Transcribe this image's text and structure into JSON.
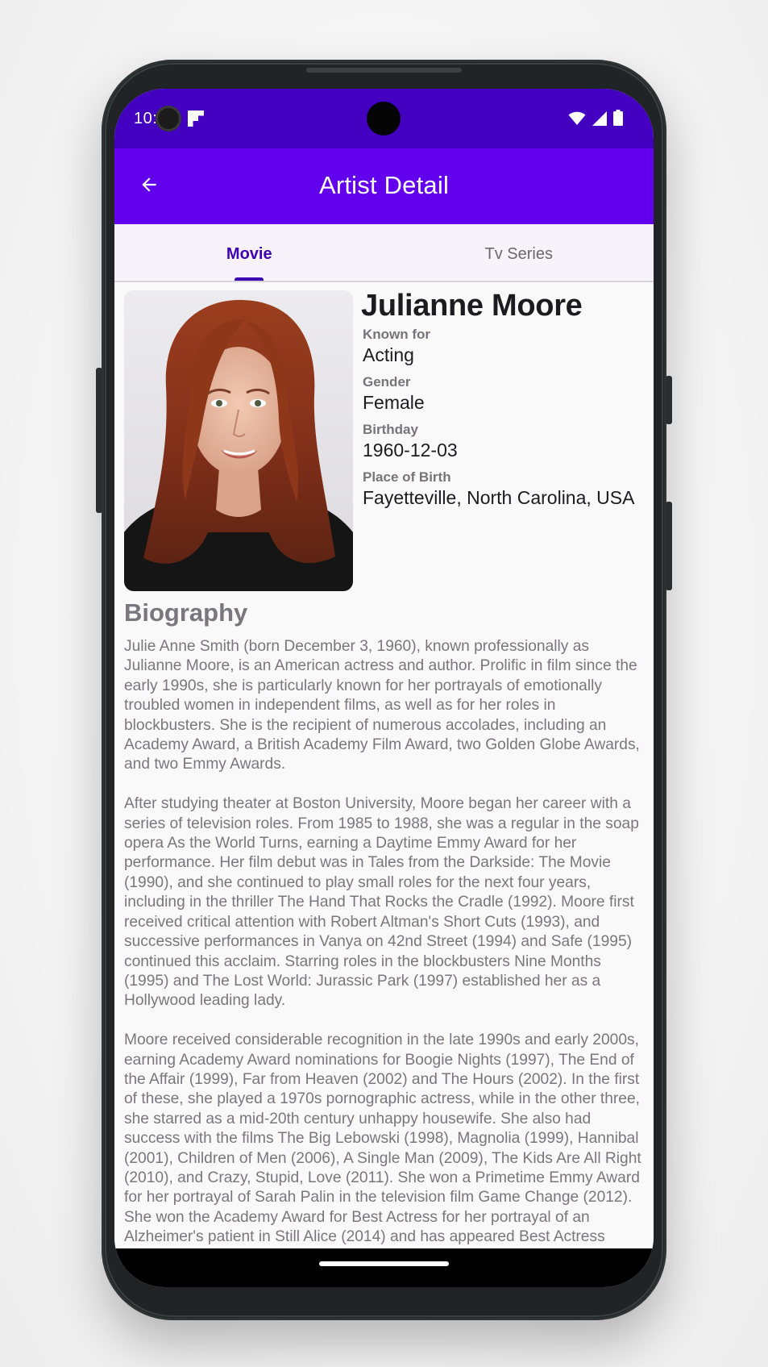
{
  "status_bar": {
    "time": "10:",
    "icons": [
      "flipboard-icon",
      "wifi-icon",
      "signal-icon",
      "battery-icon"
    ]
  },
  "app_bar": {
    "title": "Artist Detail",
    "back_icon": "arrow-back-icon"
  },
  "tabs": [
    {
      "label": "Movie",
      "selected": true
    },
    {
      "label": "Tv Series",
      "selected": false
    }
  ],
  "artist": {
    "name": "Julianne Moore",
    "fields": [
      {
        "label": "Known for",
        "value": "Acting"
      },
      {
        "label": "Gender",
        "value": "Female"
      },
      {
        "label": "Birthday",
        "value": "1960-12-03"
      },
      {
        "label": "Place of Birth",
        "value": "Fayetteville, North Carolina, USA"
      }
    ]
  },
  "biography": {
    "title": "Biography",
    "text": "Julie Anne Smith (born December 3, 1960), known professionally as Julianne Moore, is an American actress and author. Prolific in film since the early 1990s, she is particularly known for her portrayals of emotionally troubled women in independent films, as well as for her roles in blockbusters. She is the recipient of numerous accolades, including an Academy Award, a British Academy Film Award, two Golden Globe Awards, and two Emmy Awards.\n\nAfter studying theater at Boston University, Moore began her career with a series of television roles. From 1985 to 1988, she was a regular in the soap opera As the World Turns, earning a Daytime Emmy Award for her performance. Her film debut was in Tales from the Darkside: The Movie (1990), and she continued to play small roles for the next four years, including in the thriller The Hand That Rocks the Cradle (1992). Moore first received critical attention with Robert Altman's Short Cuts (1993), and successive performances in Vanya on 42nd Street (1994) and Safe (1995) continued this acclaim. Starring roles in the blockbusters Nine Months (1995) and The Lost World: Jurassic Park (1997) established her as a Hollywood leading lady.\n\nMoore received considerable recognition in the late 1990s and early 2000s, earning Academy Award nominations for Boogie Nights (1997), The End of the Affair (1999), Far from Heaven (2002) and The Hours (2002). In the first of these, she played a 1970s pornographic actress, while in the other three, she starred as a mid-20th century unhappy housewife. She also had success with the films The Big Lebowski (1998), Magnolia (1999), Hannibal (2001), Children of Men (2006), A Single Man (2009), The Kids Are All Right (2010), and Crazy, Stupid, Love (2011). She won a Primetime Emmy Award for her portrayal of Sarah Palin in the television film Game Change (2012). She won the Academy Award for Best Actress for her portrayal of an Alzheimer's patient in Still Alice (2014) and has appeared Best Actress"
  },
  "colors": {
    "status_bar": "#4300c0",
    "app_bar": "#6200ee",
    "tab_active": "#3d00b3",
    "tab_inactive": "#6d6770",
    "tabs_background": "#f8f3fb"
  }
}
